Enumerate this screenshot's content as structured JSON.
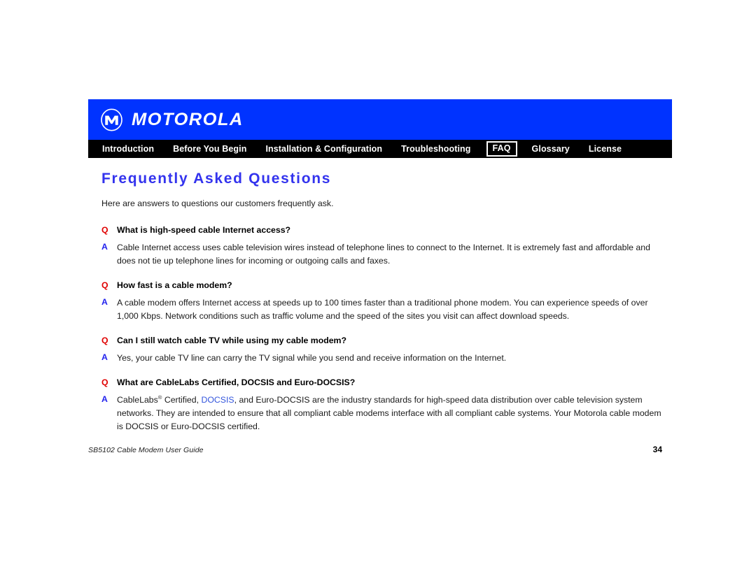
{
  "banner": {
    "logo_icon": "motorola-batwing-logo",
    "wordmark": "MOTOROLA",
    "background_color": "#0033FF"
  },
  "nav": {
    "background_color": "#000000",
    "items": [
      {
        "label": "Introduction",
        "current": false
      },
      {
        "label": "Before You Begin",
        "current": false
      },
      {
        "label": "Installation & Configuration",
        "current": false
      },
      {
        "label": "Troubleshooting",
        "current": false
      },
      {
        "label": "FAQ",
        "current": true
      },
      {
        "label": "Glossary",
        "current": false
      },
      {
        "label": "License",
        "current": false
      }
    ]
  },
  "main": {
    "title": "Frequently Asked Questions",
    "title_color": "#3333EE",
    "intro": "Here are answers to questions our customers frequently ask.",
    "q_marker": "Q",
    "a_marker": "A",
    "q_marker_color": "#E00000",
    "a_marker_color": "#2222EE",
    "faqs": [
      {
        "question": "What is high-speed cable Internet access?",
        "answer": "Cable Internet access uses cable television wires instead of telephone lines to connect to the Internet. It is extremely fast and affordable and does not tie up telephone lines for incoming or outgoing calls and faxes."
      },
      {
        "question": "How fast is a cable modem?",
        "answer": "A cable modem offers Internet access at speeds up to 100 times faster than a traditional phone modem. You can experience speeds of over 1,000 Kbps. Network conditions such as traffic volume and the speed of the sites you visit can affect download speeds."
      },
      {
        "question": "Can I still watch cable TV while using my cable modem?",
        "answer": "Yes, your cable TV line can carry the TV signal while you send and receive information on the Internet."
      },
      {
        "question": "What are CableLabs Certified, DOCSIS and Euro-DOCSIS?",
        "answer_part1": "CableLabs",
        "answer_superscript": "®",
        "answer_part2": " Certified, ",
        "answer_link": "DOCSIS",
        "answer_link_color": "#3355DD",
        "answer_part3": ", and Euro-DOCSIS are the industry standards for high-speed data distribution over cable television system networks. They are intended to ensure that all compliant cable modems interface with all compliant cable systems. Your Motorola cable modem is DOCSIS or Euro-DOCSIS certified."
      }
    ]
  },
  "footer": {
    "document_title": "SB5102 Cable Modem User Guide",
    "page_number": "34"
  }
}
